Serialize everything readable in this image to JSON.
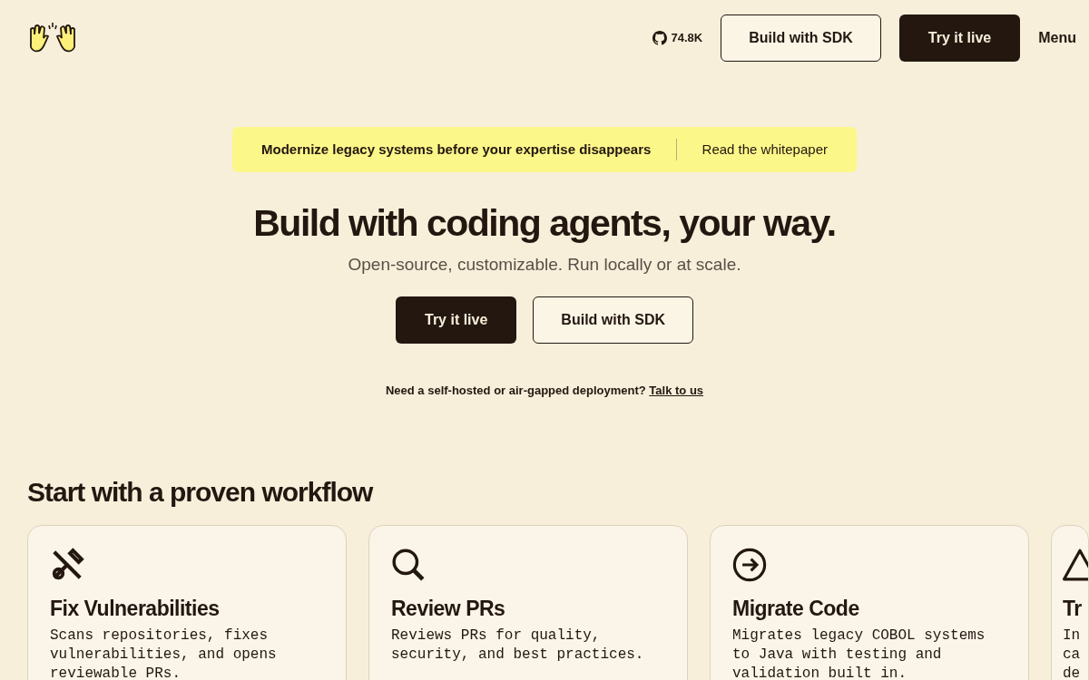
{
  "header": {
    "github_stars": "74.8K",
    "buttons": [
      {
        "label": "Build with SDK",
        "kind": "outline"
      },
      {
        "label": "Try it live",
        "kind": "solid"
      }
    ],
    "menu": "Menu"
  },
  "banner": {
    "message": "Modernize legacy systems before your expertise disappears",
    "link": "Read the whitepaper"
  },
  "hero": {
    "title": "Build with coding agents, your way.",
    "subtitle": "Open-source, customizable. Run locally or at scale.",
    "buttons": [
      {
        "label": "Try it live",
        "kind": "solid"
      },
      {
        "label": "Build with SDK",
        "kind": "outline"
      }
    ],
    "note": "Need a self-hosted or air-gapped deployment?",
    "note_link": "Talk to us"
  },
  "workflows": {
    "heading": "Start with a proven workflow",
    "cards": [
      {
        "title": "Fix Vulnerabilities",
        "lines": [
          "Scans repositories, fixes",
          "vulnerabilities, and opens",
          "reviewable PRs."
        ]
      },
      {
        "title": "Review PRs",
        "lines": [
          "Reviews PRs for quality,",
          "security, and best practices."
        ]
      },
      {
        "title": "Migrate Code",
        "lines": [
          "Migrates legacy COBOL systems",
          "to Java with testing and",
          "validation built in."
        ]
      },
      {
        "title": "Tr",
        "lines": [
          "In",
          "ca",
          "de"
        ]
      }
    ]
  }
}
